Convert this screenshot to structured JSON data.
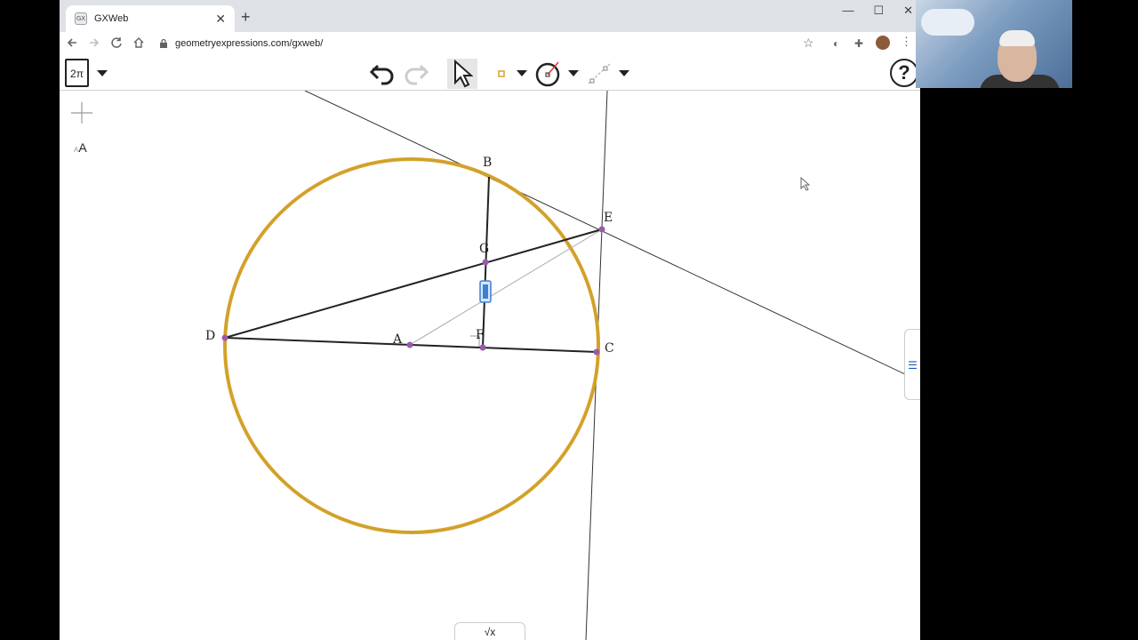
{
  "browser": {
    "tab_title": "GXWeb",
    "tab_favicon": "GX",
    "tab_close": "✕",
    "new_tab": "+",
    "window_controls": [
      "—",
      "☐",
      "✕"
    ],
    "url": "geometryexpressions.com/gxweb/"
  },
  "app": {
    "doc_label": "2π",
    "help_label": "?",
    "font_tool_label": "A",
    "font_tool_small": "A",
    "math_tab_label": "√x"
  },
  "icons": {
    "back": "arrow-left-icon",
    "forward": "arrow-right-icon",
    "reload": "reload-icon",
    "home": "home-icon",
    "lock": "lock-icon",
    "star": "star-icon",
    "extension": "puzzle-icon",
    "profile": "avatar",
    "menu": "kebab-icon",
    "undo": "undo-icon",
    "redo": "redo-icon",
    "select": "pointer-arrow-icon",
    "point": "point-icon",
    "circle": "circle-tool-icon",
    "line": "line-tool-icon",
    "crosshair": "crosshair-icon",
    "side_panel": "list-icon"
  },
  "colors": {
    "circle_stroke": "#d9a227",
    "point_fill": "#9a5aa8",
    "selection": "#3d7fd6"
  },
  "geometry": {
    "labels": {
      "A": "A",
      "B": "B",
      "C": "C",
      "D": "D",
      "E": "E",
      "F": "F",
      "G": "G"
    }
  }
}
